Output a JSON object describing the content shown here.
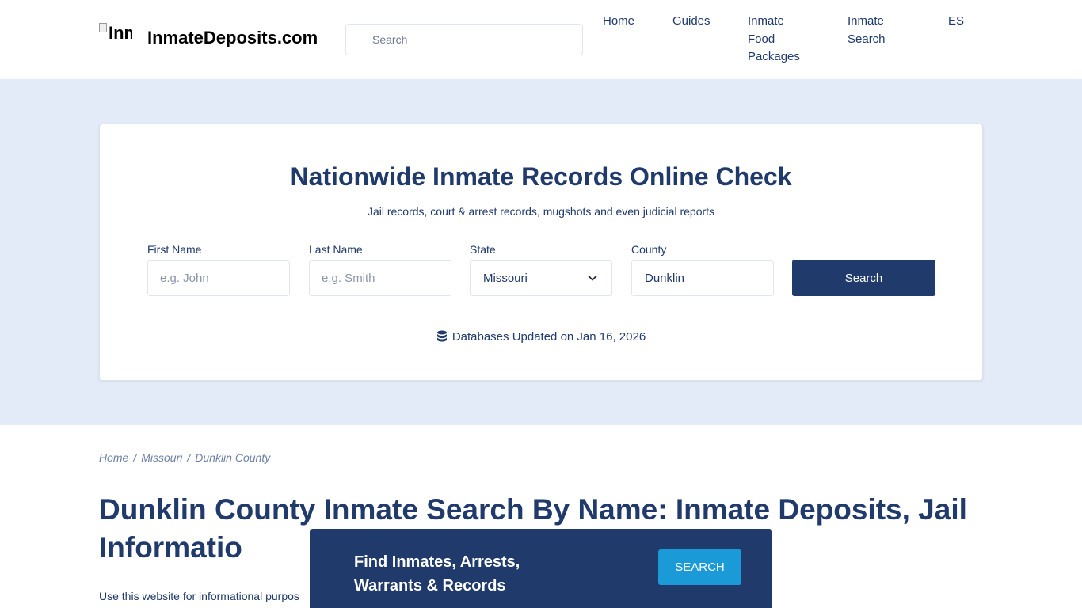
{
  "header": {
    "logo_alt": "Inmate",
    "site_name": "InmateDeposits.com",
    "search_placeholder": "Search",
    "nav": [
      {
        "label": "Home"
      },
      {
        "label": "Guides"
      },
      {
        "label_lines": [
          "Inmate",
          "Food",
          "Packages"
        ]
      },
      {
        "label_lines": [
          "Inmate",
          "Search"
        ]
      },
      {
        "label": "ES"
      }
    ]
  },
  "hero": {
    "title": "Nationwide Inmate Records Online Check",
    "subtitle": "Jail records, court & arrest records, mugshots and even judicial reports",
    "fields": {
      "first_name": {
        "label": "First Name",
        "placeholder": "e.g. John"
      },
      "last_name": {
        "label": "Last Name",
        "placeholder": "e.g. Smith"
      },
      "state": {
        "label": "State",
        "value": "Missouri"
      },
      "county": {
        "label": "County",
        "value": "Dunklin"
      }
    },
    "search_label": "Search",
    "db_updated": "Databases Updated on Jan 16, 2026"
  },
  "breadcrumb": {
    "items": [
      "Home",
      "Missouri",
      "Dunklin County"
    ],
    "separator": "/"
  },
  "page": {
    "title": "Dunklin County Inmate Search By Name: Inmate Deposits, Jail Informatio",
    "body_text": "Use this website for informational purpos"
  },
  "banner": {
    "text_line1": "Find Inmates, Arrests,",
    "text_line2": "Warrants & Records",
    "button_label": "SEARCH"
  },
  "colors": {
    "primary": "#1f3a6b",
    "hero_bg": "#e3ebf8",
    "banner_button": "#1a9ad6"
  }
}
